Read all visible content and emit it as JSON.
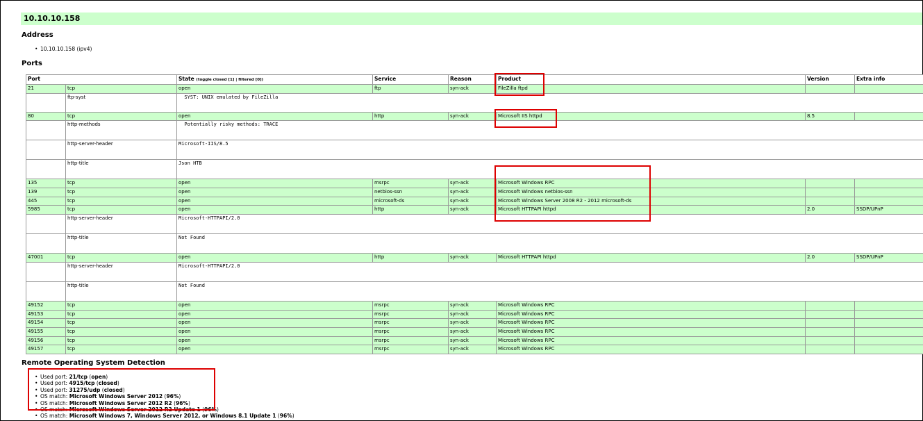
{
  "host": {
    "title": "10.10.10.158"
  },
  "address": {
    "heading": "Address",
    "items": [
      "10.10.10.158 (ipv4)"
    ]
  },
  "ports": {
    "heading": "Ports",
    "columns": {
      "port": "Port",
      "state": "State",
      "state_toggle": "(toggle closed [1] | filtered [0])",
      "service": "Service",
      "reason": "Reason",
      "product": "Product",
      "version": "Version",
      "extra": "Extra info"
    },
    "rows": [
      {
        "type": "port",
        "port": "21",
        "proto": "tcp",
        "state": "open",
        "service": "ftp",
        "reason": "syn-ack",
        "product": "FileZilla ftpd",
        "version": "",
        "extra": ""
      },
      {
        "type": "script",
        "name": "ftp-syst",
        "output": "  SYST: UNIX emulated by FileZilla",
        "h": 27
      },
      {
        "type": "port",
        "port": "80",
        "proto": "tcp",
        "state": "open",
        "service": "http",
        "reason": "syn-ack",
        "product": "Microsoft IIS httpd",
        "version": "8.5",
        "extra": ""
      },
      {
        "type": "script",
        "name": "http-methods",
        "output": "  Potentially risky methods: TRACE",
        "h": 28
      },
      {
        "type": "script",
        "name": "http-server-header",
        "output": "Microsoft-IIS/8.5",
        "h": 28
      },
      {
        "type": "script",
        "name": "http-title",
        "output": "Json HTB",
        "h": 28
      },
      {
        "type": "port",
        "port": "135",
        "proto": "tcp",
        "state": "open",
        "service": "msrpc",
        "reason": "syn-ack",
        "product": "Microsoft Windows RPC",
        "version": "",
        "extra": ""
      },
      {
        "type": "port",
        "port": "139",
        "proto": "tcp",
        "state": "open",
        "service": "netbios-ssn",
        "reason": "syn-ack",
        "product": "Microsoft Windows netbios-ssn",
        "version": "",
        "extra": ""
      },
      {
        "type": "port",
        "port": "445",
        "proto": "tcp",
        "state": "open",
        "service": "microsoft-ds",
        "reason": "syn-ack",
        "product": "Microsoft Windows Server 2008 R2 - 2012 microsoft-ds",
        "version": "",
        "extra": ""
      },
      {
        "type": "port",
        "port": "5985",
        "proto": "tcp",
        "state": "open",
        "service": "http",
        "reason": "syn-ack",
        "product": "Microsoft HTTPAPI httpd",
        "version": "2.0",
        "extra": "SSDP/UPnP"
      },
      {
        "type": "script",
        "name": "http-server-header",
        "output": "Microsoft-HTTPAPI/2.0",
        "h": 28
      },
      {
        "type": "script",
        "name": "http-title",
        "output": "Not Found",
        "h": 28
      },
      {
        "type": "port",
        "port": "47001",
        "proto": "tcp",
        "state": "open",
        "service": "http",
        "reason": "syn-ack",
        "product": "Microsoft HTTPAPI httpd",
        "version": "2.0",
        "extra": "SSDP/UPnP"
      },
      {
        "type": "script",
        "name": "http-server-header",
        "output": "Microsoft-HTTPAPI/2.0",
        "h": 28
      },
      {
        "type": "script",
        "name": "http-title",
        "output": "Not Found",
        "h": 28
      },
      {
        "type": "port",
        "port": "49152",
        "proto": "tcp",
        "state": "open",
        "service": "msrpc",
        "reason": "syn-ack",
        "product": "Microsoft Windows RPC",
        "version": "",
        "extra": ""
      },
      {
        "type": "port",
        "port": "49153",
        "proto": "tcp",
        "state": "open",
        "service": "msrpc",
        "reason": "syn-ack",
        "product": "Microsoft Windows RPC",
        "version": "",
        "extra": ""
      },
      {
        "type": "port",
        "port": "49154",
        "proto": "tcp",
        "state": "open",
        "service": "msrpc",
        "reason": "syn-ack",
        "product": "Microsoft Windows RPC",
        "version": "",
        "extra": ""
      },
      {
        "type": "port",
        "port": "49155",
        "proto": "tcp",
        "state": "open",
        "service": "msrpc",
        "reason": "syn-ack",
        "product": "Microsoft Windows RPC",
        "version": "",
        "extra": ""
      },
      {
        "type": "port",
        "port": "49156",
        "proto": "tcp",
        "state": "open",
        "service": "msrpc",
        "reason": "syn-ack",
        "product": "Microsoft Windows RPC",
        "version": "",
        "extra": ""
      },
      {
        "type": "port",
        "port": "49157",
        "proto": "tcp",
        "state": "open",
        "service": "msrpc",
        "reason": "syn-ack",
        "product": "Microsoft Windows RPC",
        "version": "",
        "extra": ""
      }
    ]
  },
  "os": {
    "heading": "Remote Operating System Detection",
    "items": [
      {
        "prefix": "Used port: ",
        "bold": "21/tcp",
        "mid": " (",
        "bold2": "open",
        "suffix": ")"
      },
      {
        "prefix": "Used port: ",
        "bold": "4915/tcp",
        "mid": " (",
        "bold2": "closed",
        "suffix": ")"
      },
      {
        "prefix": "Used port: ",
        "bold": "31275/udp",
        "mid": " (",
        "bold2": "closed",
        "suffix": ")"
      },
      {
        "prefix": "OS match: ",
        "bold": "Microsoft Windows Server 2012",
        "mid": " (",
        "bold2": "96%",
        "suffix": ")"
      },
      {
        "prefix": "OS match: ",
        "bold": "Microsoft Windows Server 2012 R2",
        "mid": " (",
        "bold2": "96%",
        "suffix": ")"
      },
      {
        "prefix": "OS match: ",
        "bold": "Microsoft Windows Server 2012 R2 Update 1",
        "mid": " (",
        "bold2": "96%",
        "suffix": ")"
      },
      {
        "prefix": "OS match: ",
        "bold": "Microsoft Windows 7, Windows Server 2012, or Windows 8.1 Update 1",
        "mid": " (",
        "bold2": "96%",
        "suffix": ")"
      }
    ]
  },
  "colors": {
    "open_row": "#ccffcc",
    "highlight": "#dd0000"
  }
}
